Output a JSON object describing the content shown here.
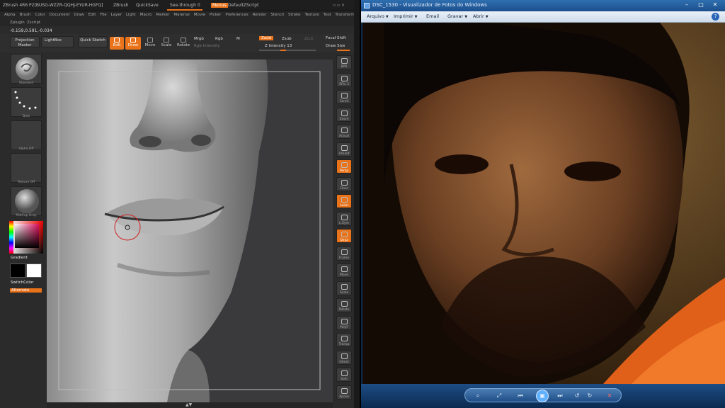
{
  "zbrush": {
    "title": "ZBrush 4R6  P2[BUSG-WZZR-QQHJ-EYUR-HGFQ]",
    "title_app": "ZBrush",
    "quicksave": "QuickSave",
    "seethrough": "See-through  0",
    "menus": "Menus",
    "script": "DefaultZScript",
    "menubar": [
      "Alpha",
      "Brush",
      "Color",
      "Document",
      "Draw",
      "Edit",
      "File",
      "Layer",
      "Light",
      "Macro",
      "Marker",
      "Material",
      "Movie",
      "Picker",
      "Preferences",
      "Render",
      "Stencil",
      "Stroke",
      "Texture",
      "Tool",
      "Transform"
    ],
    "submenu": [
      "Zplugin",
      "Zscript"
    ],
    "coords": "-0.159,0.591,-0.034",
    "toolbar": {
      "projection_master": "Projection Master",
      "lightbox": "LightBox",
      "quick_sketch": "Quick Sketch",
      "edit": "Edit",
      "draw": "Draw",
      "move": "Move",
      "scale": "Scale",
      "rotate": "Rotate",
      "mrgb": "Mrgb",
      "rgb": "Rgb",
      "m": "M",
      "rgb_intensity": "Rgb Intensity",
      "zadd": "Zadd",
      "zsub": "Zsub",
      "zcut": "Zcut",
      "z_intensity": "Z Intensity 13",
      "focal_shift": "Focal Shift",
      "draw_size": "Draw Size"
    },
    "left_panel": {
      "standard": "Standard",
      "dots": "Dots",
      "alpha_off": "Alpha Off",
      "texture_off": "Texture Off",
      "material": "MatCap Gray",
      "gradient": "Gradient",
      "switch_color": "SwitchColor",
      "alternate": "Alternate"
    },
    "right_shelf": [
      {
        "label": "BPR",
        "orange": false
      },
      {
        "label": "SPix 3",
        "orange": false
      },
      {
        "label": "Scroll",
        "orange": false
      },
      {
        "label": "Zoom",
        "orange": false
      },
      {
        "label": "Actual",
        "orange": false
      },
      {
        "label": "AAHalf",
        "orange": false
      },
      {
        "label": "Persp",
        "orange": true
      },
      {
        "label": "Floor",
        "orange": false
      },
      {
        "label": "Local",
        "orange": true
      },
      {
        "label": "L.Sym",
        "orange": false
      },
      {
        "label": "Qxyz",
        "orange": true
      },
      {
        "label": "Frame",
        "orange": false
      },
      {
        "label": "Move",
        "orange": false
      },
      {
        "label": "Scale",
        "orange": false
      },
      {
        "label": "Rotate",
        "orange": false
      },
      {
        "label": "PolyF",
        "orange": false
      },
      {
        "label": "Transp",
        "orange": false
      },
      {
        "label": "Ghost",
        "orange": false
      },
      {
        "label": "Solo",
        "orange": false
      },
      {
        "label": "Xpose",
        "orange": false
      }
    ],
    "colors": {
      "accent": "#e8731b",
      "panel": "#2b2b2b",
      "canvas": "#3a3a3c"
    }
  },
  "photo_viewer": {
    "title": "DSC_1530 - Visualizador de Fotos do Windows",
    "menu": [
      {
        "label": "Arquivo",
        "dropdown": true
      },
      {
        "label": "Imprimir",
        "dropdown": true
      },
      {
        "label": "Email",
        "dropdown": false
      },
      {
        "label": "Gravar",
        "dropdown": true
      },
      {
        "label": "Abrir",
        "dropdown": true
      }
    ],
    "help": "?",
    "controls": {
      "zoom": "⌕",
      "fit": "⤢",
      "prev": "⏮",
      "slideshow": "▣",
      "next": "⏭",
      "rotate_ccw": "↺",
      "rotate_cw": "↻",
      "delete": "✕"
    },
    "window_buttons": {
      "minimize": "–",
      "maximize": "□",
      "close": "✕"
    }
  }
}
